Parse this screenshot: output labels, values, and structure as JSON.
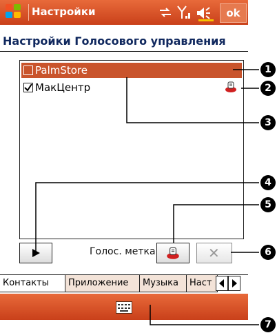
{
  "titlebar": {
    "title": "Настройки",
    "ok_label": "ok"
  },
  "page": {
    "heading": "Настройки Голосового управления"
  },
  "list": {
    "items": [
      {
        "label": "PalmStore",
        "checked": false,
        "selected": true
      },
      {
        "label": "МакЦентр",
        "checked": true,
        "selected": false
      }
    ]
  },
  "controls": {
    "voice_tag_label": "Голос. метка:",
    "delete_symbol": "✕",
    "play_symbol": "▶"
  },
  "tabs": [
    {
      "label": "Контакты"
    },
    {
      "label": "Приложение"
    },
    {
      "label": "Музыка"
    },
    {
      "label": "Наст"
    }
  ],
  "callouts": [
    "1",
    "2",
    "3",
    "4",
    "5",
    "6",
    "7"
  ],
  "colors": {
    "accent": "#d2512a",
    "selection": "#c9542c",
    "heading": "#10285e"
  }
}
